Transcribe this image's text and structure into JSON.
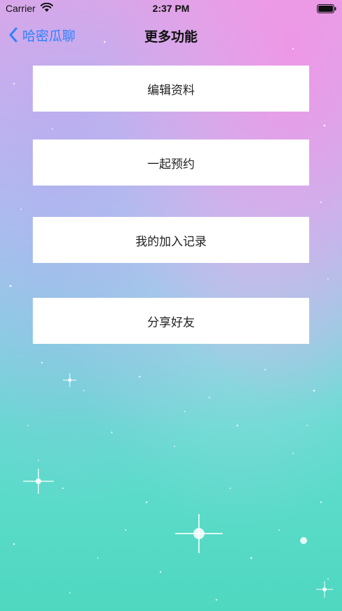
{
  "status_bar": {
    "carrier": "Carrier",
    "time": "2:37 PM"
  },
  "nav": {
    "back_label": "哈密瓜聊",
    "title": "更多功能",
    "accent_color": "#2f80ff"
  },
  "menu": {
    "items": [
      {
        "label": "编辑资料"
      },
      {
        "label": "一起预约"
      },
      {
        "label": "我的加入记录"
      },
      {
        "label": "分享好友"
      }
    ]
  },
  "icons": [
    "wifi-icon",
    "battery-icon",
    "chevron-left-icon"
  ]
}
